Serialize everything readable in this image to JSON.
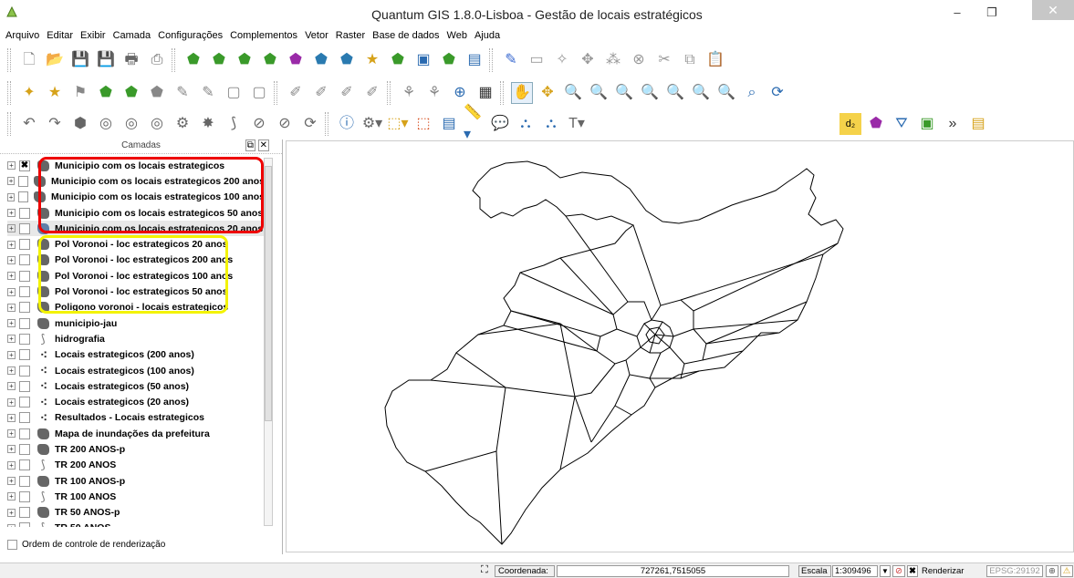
{
  "window": {
    "title": "Quantum GIS 1.8.0-Lisboa - Gestão de locais estratégicos"
  },
  "menu": [
    "Arquivo",
    "Editar",
    "Exibir",
    "Camada",
    "Configurações",
    "Complementos",
    "Vetor",
    "Raster",
    "Base de dados",
    "Web",
    "Ajuda"
  ],
  "layers_panel": {
    "title": "Camadas",
    "layers": [
      {
        "name": "Municipio com os locais estrategicos",
        "icon": "polygon",
        "checked": true
      },
      {
        "name": "Municipio com os locais estrategicos 200 anos",
        "icon": "polygon",
        "checked": false
      },
      {
        "name": "Municipio com os locais estrategicos 100 anos",
        "icon": "polygon",
        "checked": false
      },
      {
        "name": "Municipio com os locais estrategicos 50 anos",
        "icon": "polygon",
        "checked": false
      },
      {
        "name": "Municipio com os locais estrategicos 20 anos",
        "icon": "polygon-blue",
        "checked": false
      },
      {
        "name": "Pol Voronoi - loc estrategicos 20 anos",
        "icon": "polygon",
        "checked": false
      },
      {
        "name": "Pol Voronoi - loc estrategicos 200 anos",
        "icon": "polygon",
        "checked": false
      },
      {
        "name": "Pol Voronoi - loc estrategicos 100 anos",
        "icon": "polygon",
        "checked": false
      },
      {
        "name": "Pol Voronoi - loc estrategicos 50 anos",
        "icon": "polygon",
        "checked": false
      },
      {
        "name": "Poligono voronoi - locais estrategicos",
        "icon": "polygon",
        "checked": false
      },
      {
        "name": "municipio-jau",
        "icon": "polygon",
        "checked": false
      },
      {
        "name": "hidrografia",
        "icon": "line",
        "checked": false
      },
      {
        "name": "Locais estrategicos (200 anos)",
        "icon": "point",
        "checked": false
      },
      {
        "name": "Locais estrategicos (100 anos)",
        "icon": "point",
        "checked": false
      },
      {
        "name": "Locais estrategicos (50 anos)",
        "icon": "point",
        "checked": false
      },
      {
        "name": "Locais estrategicos (20 anos)",
        "icon": "point",
        "checked": false
      },
      {
        "name": "Resultados - Locais estrategicos",
        "icon": "point",
        "checked": false
      },
      {
        "name": "Mapa de inundações da prefeitura",
        "icon": "polygon",
        "checked": false
      },
      {
        "name": "TR 200 ANOS-p",
        "icon": "polygon",
        "checked": false
      },
      {
        "name": "TR 200 ANOS",
        "icon": "line",
        "checked": false
      },
      {
        "name": "TR 100 ANOS-p",
        "icon": "polygon",
        "checked": false
      },
      {
        "name": "TR 100 ANOS",
        "icon": "line",
        "checked": false
      },
      {
        "name": "TR 50 ANOS-p",
        "icon": "polygon",
        "checked": false
      },
      {
        "name": "TR 50 ANOS",
        "icon": "line",
        "checked": false
      }
    ],
    "render_order_label": "Ordem de controle de renderização"
  },
  "status": {
    "coordinate_label": "Coordenada:",
    "coordinate_value": "727261,7515055",
    "scale_label": "Escala",
    "scale_value": "1:309496",
    "render_label": "Renderizar",
    "epsg": "EPSG:29192"
  },
  "colors": {
    "highlight_red": "#e00000",
    "highlight_yellow": "#f3f300"
  }
}
